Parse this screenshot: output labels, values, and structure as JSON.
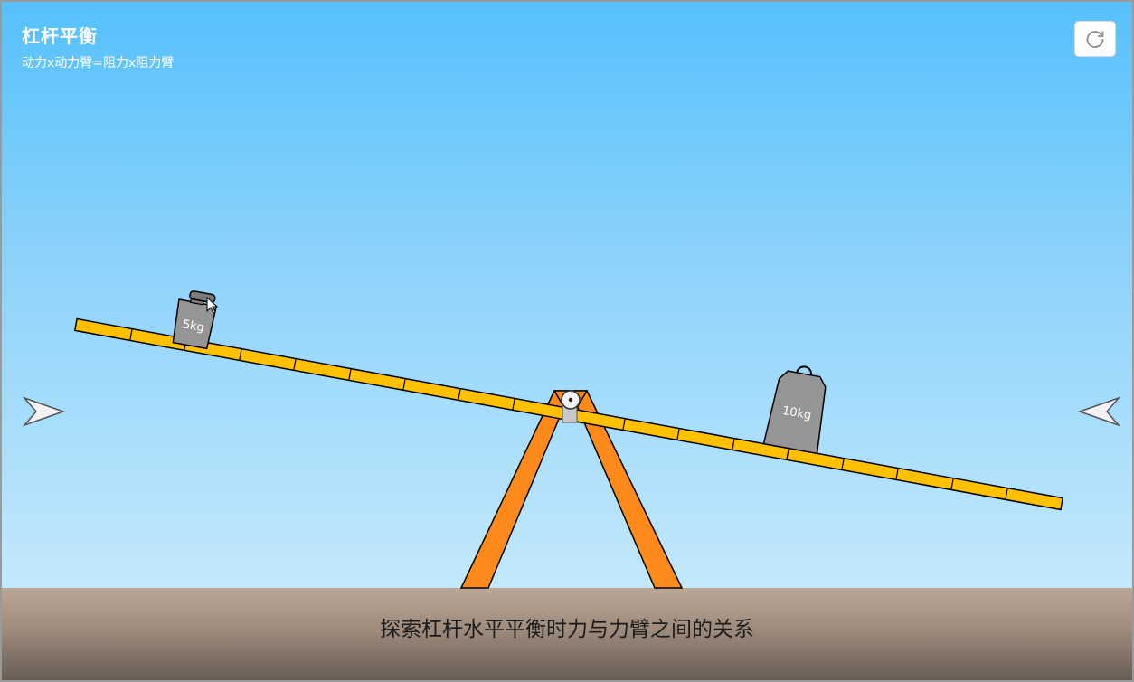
{
  "header": {
    "title": "杠杆平衡",
    "formula": "动力x动力臂=阻力x阻力臂"
  },
  "controls": {
    "reset_icon": "refresh-icon",
    "left_arrow_icon": "arrow-left-icon",
    "right_arrow_icon": "arrow-right-icon"
  },
  "weights": {
    "left_label": "5kg",
    "right_label": "10kg"
  },
  "caption": "探索杠杆水平平衡时力与力臂之间的关系",
  "colors": {
    "sky_top": "#56c0fc",
    "sky_bottom": "#c3e8fc",
    "beam": "#ffc000",
    "stand": "#ff8a1c",
    "weight": "#959595",
    "ground": "#bba797"
  }
}
